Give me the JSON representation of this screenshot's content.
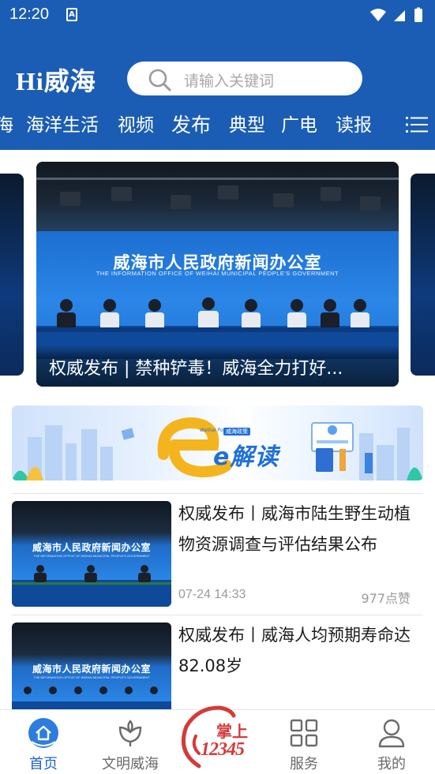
{
  "status_bar": {
    "time": "12:20",
    "notification_icon": "A"
  },
  "header": {
    "logo": "Hi威海",
    "search_placeholder": "请输入关键词"
  },
  "channels": [
    {
      "label": "海"
    },
    {
      "label": "海洋生活"
    },
    {
      "label": "视频"
    },
    {
      "label": "发布"
    },
    {
      "label": "典型"
    },
    {
      "label": "广电"
    },
    {
      "label": "读报"
    }
  ],
  "carousel": {
    "backdrop_title": "威海市人民政府新闻办公室",
    "backdrop_subtitle": "THE INFORMATION OFFICE OF WEIHAI MUNICIPAL PEOPLE'S GOVERNMENT",
    "caption": "权威发布 | 禁种铲毒！威海全力打好..."
  },
  "banner": {
    "pre_tag": "Weihai Policy",
    "tag": "威海政策",
    "text": "e解读"
  },
  "news": [
    {
      "thumb_title": "威海市人民政府新闻办公室",
      "thumb_subtitle": "THE INFORMATION OFFICE OF WEIHAI MUNICIPAL PEOPLE'S GOVERNMENT",
      "title": "权威发布丨威海市陆生野生动植物资源调查与评估结果公布",
      "time": "07-24 14:33",
      "likes": "977点赞"
    },
    {
      "thumb_title": "威海市人民政府新闻办公室",
      "thumb_subtitle": "THE INFORMATION OFFICE OF WEIHAI MUNICIPAL PEOPLE'S GOVERNMENT",
      "title": "权威发布丨威海人均预期寿命达82.08岁",
      "time": "",
      "likes": ""
    }
  ],
  "bottom_nav": [
    {
      "label": "首页",
      "icon": "home-icon",
      "active": true
    },
    {
      "label": "文明威海",
      "icon": "flower-icon",
      "active": false
    },
    {
      "label": "掌上12345",
      "icon": "hotline-logo",
      "active": false
    },
    {
      "label": "服务",
      "icon": "grid-icon",
      "active": false
    },
    {
      "label": "我的",
      "icon": "user-icon",
      "active": false
    }
  ],
  "center_logo": {
    "top": "掌上",
    "bottom": "12345"
  },
  "colors": {
    "brand_blue": "#1b5db4",
    "active_nav": "#1b64c8",
    "hotline_red": "#d43a3a"
  }
}
